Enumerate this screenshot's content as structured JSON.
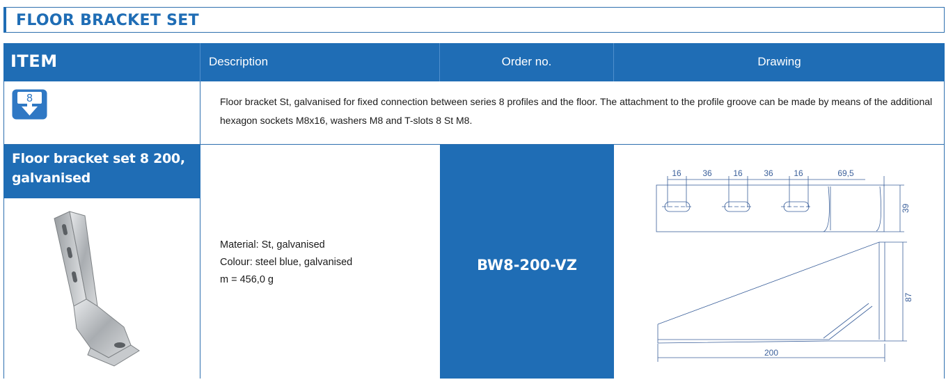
{
  "title": "FLOOR BRACKET SET",
  "header": {
    "item": "ITEM",
    "description": "Description",
    "order_no": "Order no.",
    "drawing": "Drawing"
  },
  "profile_icon": {
    "series": "8",
    "icon": "profile-series-icon",
    "color": "#2f78c4"
  },
  "intro": "Floor bracket St, galvanised for fixed connection between series 8 profiles and the floor. The attachment to the profile groove can be made by means of the additional hexagon sockets M8x16, washers M8 and T-slots 8 St M8.",
  "product": {
    "title_line1": "Floor bracket set 8 200,",
    "title_line2": "galvanised",
    "material": "Material: St, galvanised",
    "colour": "Colour: steel blue, galvanised",
    "mass": "m = 456,0 g",
    "order_no": "BW8-200-VZ"
  },
  "drawing": {
    "dim_16a": "16",
    "dim_36a": "36",
    "dim_16b": "16",
    "dim_36b": "36",
    "dim_16c": "16",
    "dim_695": "69,5",
    "dim_39": "39",
    "dim_87": "87",
    "dim_200": "200"
  },
  "colors": {
    "brand_blue": "#1f6db5",
    "border": "#2d6fae"
  }
}
